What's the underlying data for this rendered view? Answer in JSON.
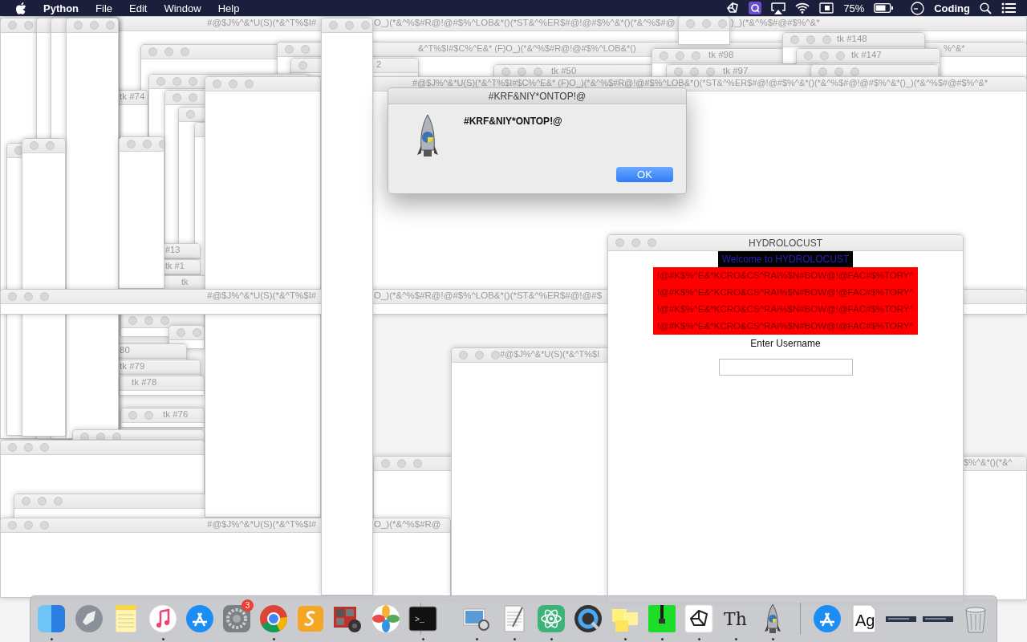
{
  "menu_bar": {
    "app": "Python",
    "menus": [
      "File",
      "Edit",
      "Window",
      "Help"
    ],
    "battery": "75%",
    "user": "Coding"
  },
  "windows": [
    {
      "kind": "window",
      "title_parts": [
        "#@$J%^&*U(S)(*&^T%$I#",
        "O_)(*&^%$#R@!@#$%^LOB&*()(*ST&^%ER$#@!@#$%^&*()(*&^%$#@",
        ")_)(*&^%$#@#$%^&*"
      ]
    },
    {
      "kind": "window"
    },
    {
      "kind": "window",
      "title_parts": [
        "&^T%$I#$C%^E&* (F)O_)(*&^%$#R@!@#$%^LOB&*()",
        "%^&*"
      ]
    },
    {
      "kind": "window",
      "title_parts": [
        "2"
      ]
    },
    {
      "kind": "window",
      "title_parts": [
        "tk #50"
      ]
    },
    {
      "kind": "window",
      "title_parts": [
        "tk #98"
      ]
    },
    {
      "kind": "window",
      "title_parts": [
        "tk #148"
      ]
    },
    {
      "kind": "window",
      "title_parts": [
        "tk #147"
      ]
    },
    {
      "kind": "window",
      "title_parts": [
        "tk #97"
      ]
    },
    {
      "kind": "window"
    },
    {
      "kind": "window"
    },
    {
      "kind": "window",
      "title_parts": [
        "#@$J%^&*U(S)(*&^T%$I#$C%^E&* (F)O_)(*&^%$#R@!@#$%^LOB&*()(*ST&^%ER$#@!@#$%^&*()(*&^%$#@!@#$%^&*()_)(*&^%$#@#$%^&*"
      ]
    },
    {
      "kind": "window",
      "title_parts": [
        "tk #74"
      ]
    },
    {
      "kind": "window"
    },
    {
      "kind": "window"
    },
    {
      "kind": "window"
    },
    {
      "kind": "window"
    },
    {
      "kind": "window",
      "title_parts": [
        "#13"
      ]
    },
    {
      "kind": "window",
      "title_parts": [
        "tk #1"
      ]
    },
    {
      "kind": "window",
      "title_parts": [
        "tk"
      ]
    },
    {
      "kind": "window"
    },
    {
      "kind": "window"
    },
    {
      "kind": "window",
      "title_parts": [
        "80"
      ]
    },
    {
      "kind": "window",
      "title_parts": [
        "tk #79"
      ]
    },
    {
      "kind": "window",
      "title_parts": [
        "tk #78"
      ]
    },
    {
      "kind": "window",
      "title_parts": [
        "tk #76"
      ]
    },
    {
      "kind": "window"
    },
    {
      "kind": "window"
    },
    {
      "kind": "window"
    },
    {
      "kind": "window"
    },
    {
      "kind": "window"
    },
    {
      "kind": "window"
    },
    {
      "kind": "window"
    },
    {
      "kind": "window"
    },
    {
      "kind": "window"
    },
    {
      "kind": "window"
    },
    {
      "kind": "window"
    },
    {
      "kind": "window",
      "title_parts": [
        "#@$J%^&*U(S)(*&^T%$I#",
        "O_)(*&^%$#R@!@#$%^LOB&*()(*ST&^%ER$#@!@#$"
      ]
    },
    {
      "kind": "window",
      "title_parts": [
        "$%^&*()(*&^"
      ]
    },
    {
      "kind": "window",
      "title_parts": [
        "#@$J%^&*U(S)(*&^T%$I#",
        "O_)(*&^%$#R@"
      ]
    },
    {
      "kind": "window",
      "title_parts": [
        "#@$J%^&*U(S)(*&^T%$I"
      ]
    },
    {
      "kind": "window"
    }
  ],
  "alert": {
    "title": "#KRF&NIY*ONTOP!@",
    "message": "#KRF&NIY*ONTOP!@",
    "button": "OK"
  },
  "login_window": {
    "title": "HYDROLOCUST",
    "welcome": "Welcome to HYDROLOCUST",
    "banner_lines": [
      "!@#K$%^E&*KCRO&CS^RAI%$N#BOW@!@FAC#$%TORY^",
      "!@#K$%^E&*KCRO&CS^RAI%$N#BOW@!@FAC#$%TORY^",
      "!@#K$%^E&*KCRO&CS^RAI%$N#BOW@!@FAC#$%TORY^",
      "!@#K$%^E&*KCRO&CS^RAI%$N#BOW@!@FAC#$%TORY^"
    ],
    "prompt": "Enter Username"
  },
  "dock": {
    "items": [
      {
        "running": true
      },
      {
        "running": false
      },
      {
        "running": false
      },
      {
        "running": true
      },
      {
        "running": false
      },
      {
        "running": false,
        "badge": "3"
      },
      {
        "running": true
      },
      {
        "running": false
      },
      {
        "running": false
      },
      {
        "running": false
      },
      {
        "running": true,
        "label": ">_"
      },
      {
        "running": true
      },
      {
        "running": true
      },
      {
        "running": true
      },
      {
        "running": false
      },
      {
        "running": true
      },
      {
        "running": true
      },
      {
        "running": true
      },
      {
        "running": true,
        "label": "Th"
      },
      {
        "running": true
      },
      {
        "running": false
      },
      {
        "running": false,
        "label": "Ag"
      },
      {
        "running": false
      },
      {
        "running": false
      },
      {
        "running": false
      }
    ]
  }
}
